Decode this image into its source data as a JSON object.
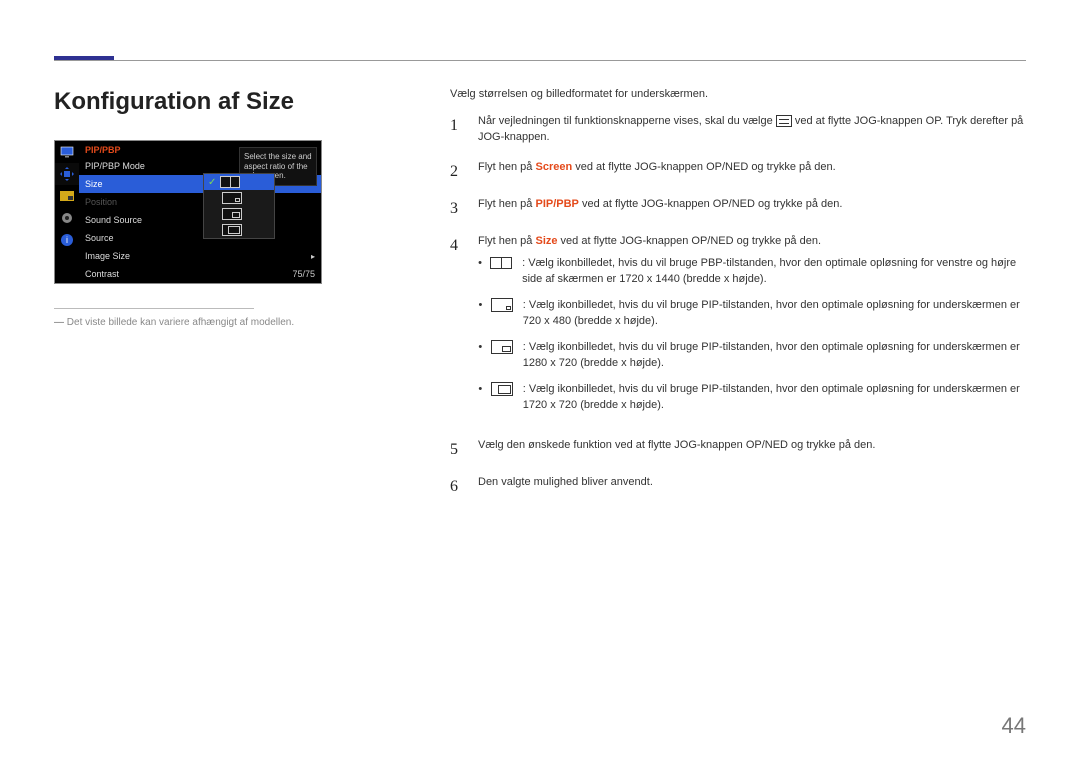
{
  "page_number": "44",
  "heading": "Konfiguration af Size",
  "footnote_text": "Det viste billede kan variere afhængigt af modellen.",
  "intro": "Vælg størrelsen og billedformatet for underskærmen.",
  "osd": {
    "header": "PIP/PBP",
    "tooltip": "Select the size and aspect ratio of the sub-screen.",
    "rows": {
      "mode": "PIP/PBP Mode",
      "size": "Size",
      "position": "Position",
      "sound": "Sound Source",
      "source": "Source",
      "image": "Image Size",
      "contrast": "Contrast",
      "contrast_val": "75/75"
    }
  },
  "steps": {
    "s1a": "Når vejledningen til funktionsknapperne vises, skal du vælge ",
    "s1b": " ved at flytte JOG-knappen OP. Tryk derefter på JOG-knappen.",
    "s2a": "Flyt hen på ",
    "s2b": "Screen",
    "s2c": " ved at flytte JOG-knappen OP/NED og trykke på den.",
    "s3a": "Flyt hen på ",
    "s3b": "PIP/PBP",
    "s3c": " ved at flytte JOG-knappen OP/NED og trykke på den.",
    "s4a": "Flyt hen på ",
    "s4b": "Size",
    "s4c": " ved at flytte JOG-knappen OP/NED og trykke på den.",
    "s5": "Vælg den ønskede funktion ved at flytte JOG-knappen OP/NED og trykke på den.",
    "s6": "Den valgte mulighed bliver anvendt."
  },
  "bullets": {
    "b1": ": Vælg ikonbilledet, hvis du vil bruge PBP-tilstanden, hvor den optimale opløsning for venstre og højre side af skærmen er 1720 x 1440 (bredde x højde).",
    "b2": ": Vælg ikonbilledet, hvis du vil bruge PIP-tilstanden, hvor den optimale opløsning for underskærmen er 720 x 480 (bredde x højde).",
    "b3": ": Vælg ikonbilledet, hvis du vil bruge PIP-tilstanden, hvor den optimale opløsning for underskærmen er 1280 x 720 (bredde x højde).",
    "b4": ": Vælg ikonbilledet, hvis du vil bruge PIP-tilstanden, hvor den optimale opløsning for underskærmen er 1720 x 720 (bredde x højde)."
  }
}
